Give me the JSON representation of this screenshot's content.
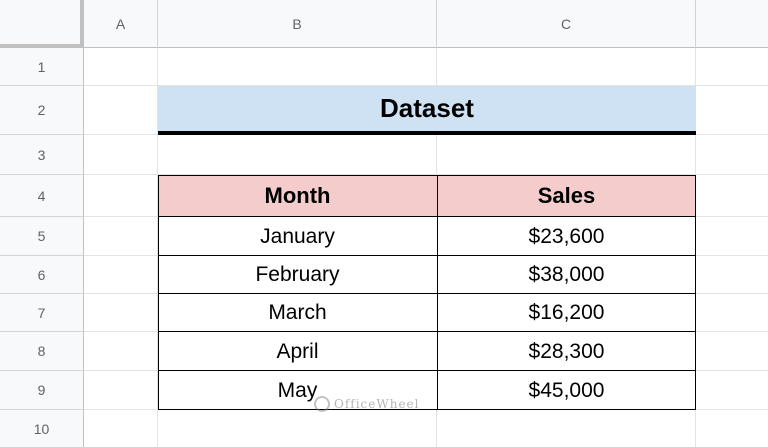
{
  "columns": [
    "A",
    "B",
    "C"
  ],
  "rows": [
    "1",
    "2",
    "3",
    "4",
    "5",
    "6",
    "7",
    "8",
    "9",
    "10"
  ],
  "title": "Dataset",
  "table": {
    "headers": [
      "Month",
      "Sales"
    ],
    "rows": [
      [
        "January",
        "$23,600"
      ],
      [
        "February",
        "$38,000"
      ],
      [
        "March",
        "$16,200"
      ],
      [
        "April",
        "$28,300"
      ],
      [
        "May",
        "$45,000"
      ]
    ]
  },
  "watermark": "OfficeWheel",
  "colors": {
    "title_fill": "#cfe2f3",
    "header_fill": "#f4cccc"
  }
}
